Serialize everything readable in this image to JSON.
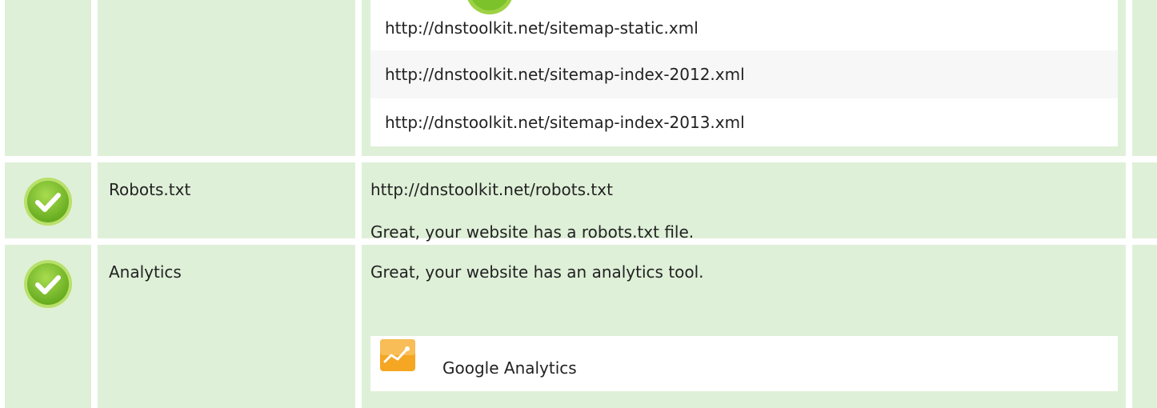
{
  "sitemaps": {
    "items": [
      "http://dnstoolkit.net/sitemap-static.xml",
      "http://dnstoolkit.net/sitemap-index-2012.xml",
      "http://dnstoolkit.net/sitemap-index-2013.xml"
    ]
  },
  "robots": {
    "label": "Robots.txt",
    "url": "http://dnstoolkit.net/robots.txt",
    "message": "Great, your website has a robots.txt file."
  },
  "analytics": {
    "label": "Analytics",
    "message": "Great, your website has an analytics tool.",
    "tool_name": "Google Analytics"
  },
  "colors": {
    "row_background": "#dff0d8",
    "check_green": "#7cc22a",
    "check_ring": "#9ed245",
    "ga_orange": "#f5a623"
  },
  "icons": {
    "status": "check-circle-icon",
    "tool": "google-analytics-icon"
  }
}
